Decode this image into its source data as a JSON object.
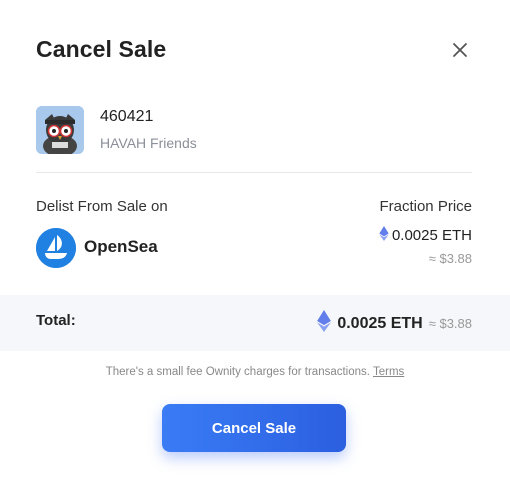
{
  "modal": {
    "title": "Cancel Sale"
  },
  "item": {
    "id": "460421",
    "collection": "HAVAH Friends"
  },
  "listing": {
    "delist_label": "Delist From Sale on",
    "price_label": "Fraction Price",
    "marketplace": "OpenSea",
    "price_eth": "0.0025 ETH",
    "price_usd": "≈ $3.88"
  },
  "total": {
    "label": "Total:",
    "eth": "0.0025 ETH",
    "usd": "≈ $3.88"
  },
  "fee_note": {
    "text": "There's a small fee Ownity charges for transactions.",
    "link": "Terms"
  },
  "actions": {
    "cancel_sale": "Cancel Sale"
  },
  "colors": {
    "accent": "#2f6ee8",
    "opensea_blue": "#2081e2",
    "eth_icon": "#627eea"
  },
  "icons": [
    "close-icon",
    "eth-icon",
    "opensea-logo"
  ]
}
